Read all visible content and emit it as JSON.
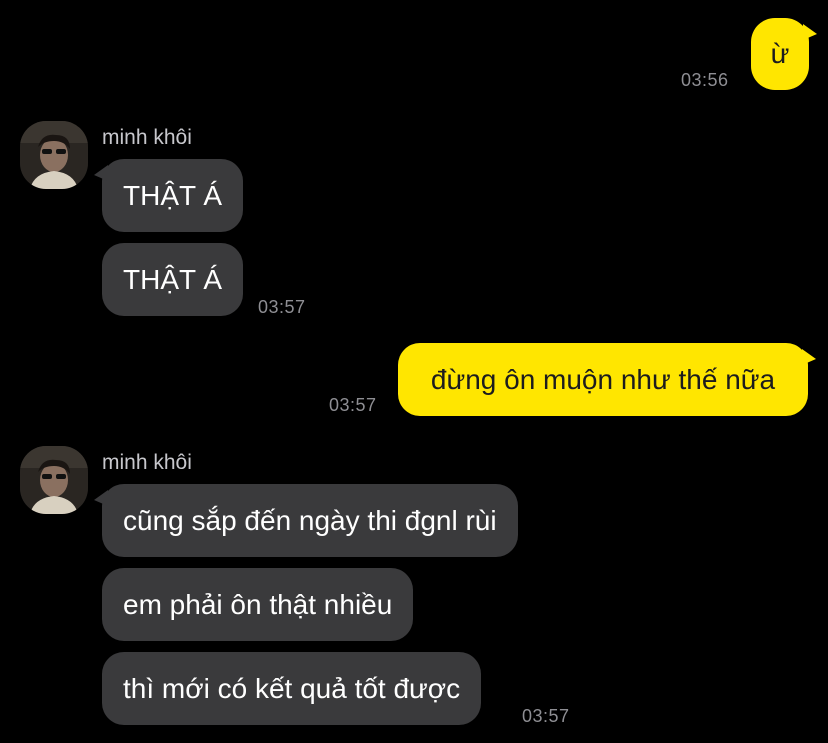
{
  "colors": {
    "background": "#000000",
    "incoming_bubble": "#3a3a3c",
    "outgoing_bubble": "#ffe600",
    "timestamp": "#8e8e93"
  },
  "messages": {
    "m1": {
      "text": "ừ",
      "time": "03:56"
    },
    "sender1": {
      "name": "minh khôi"
    },
    "m2": {
      "text": "THẬT Á"
    },
    "m3": {
      "text": "THẬT Á",
      "time": "03:57"
    },
    "m4": {
      "text": "đừng ôn muộn như thế nữa",
      "time": "03:57"
    },
    "sender2": {
      "name": "minh khôi"
    },
    "m5": {
      "text": "cũng sắp đến ngày thi đgnl rùi"
    },
    "m6": {
      "text": "em phải ôn thật nhiều"
    },
    "m7": {
      "text": "thì mới có kết quả tốt được",
      "time": "03:57"
    }
  }
}
